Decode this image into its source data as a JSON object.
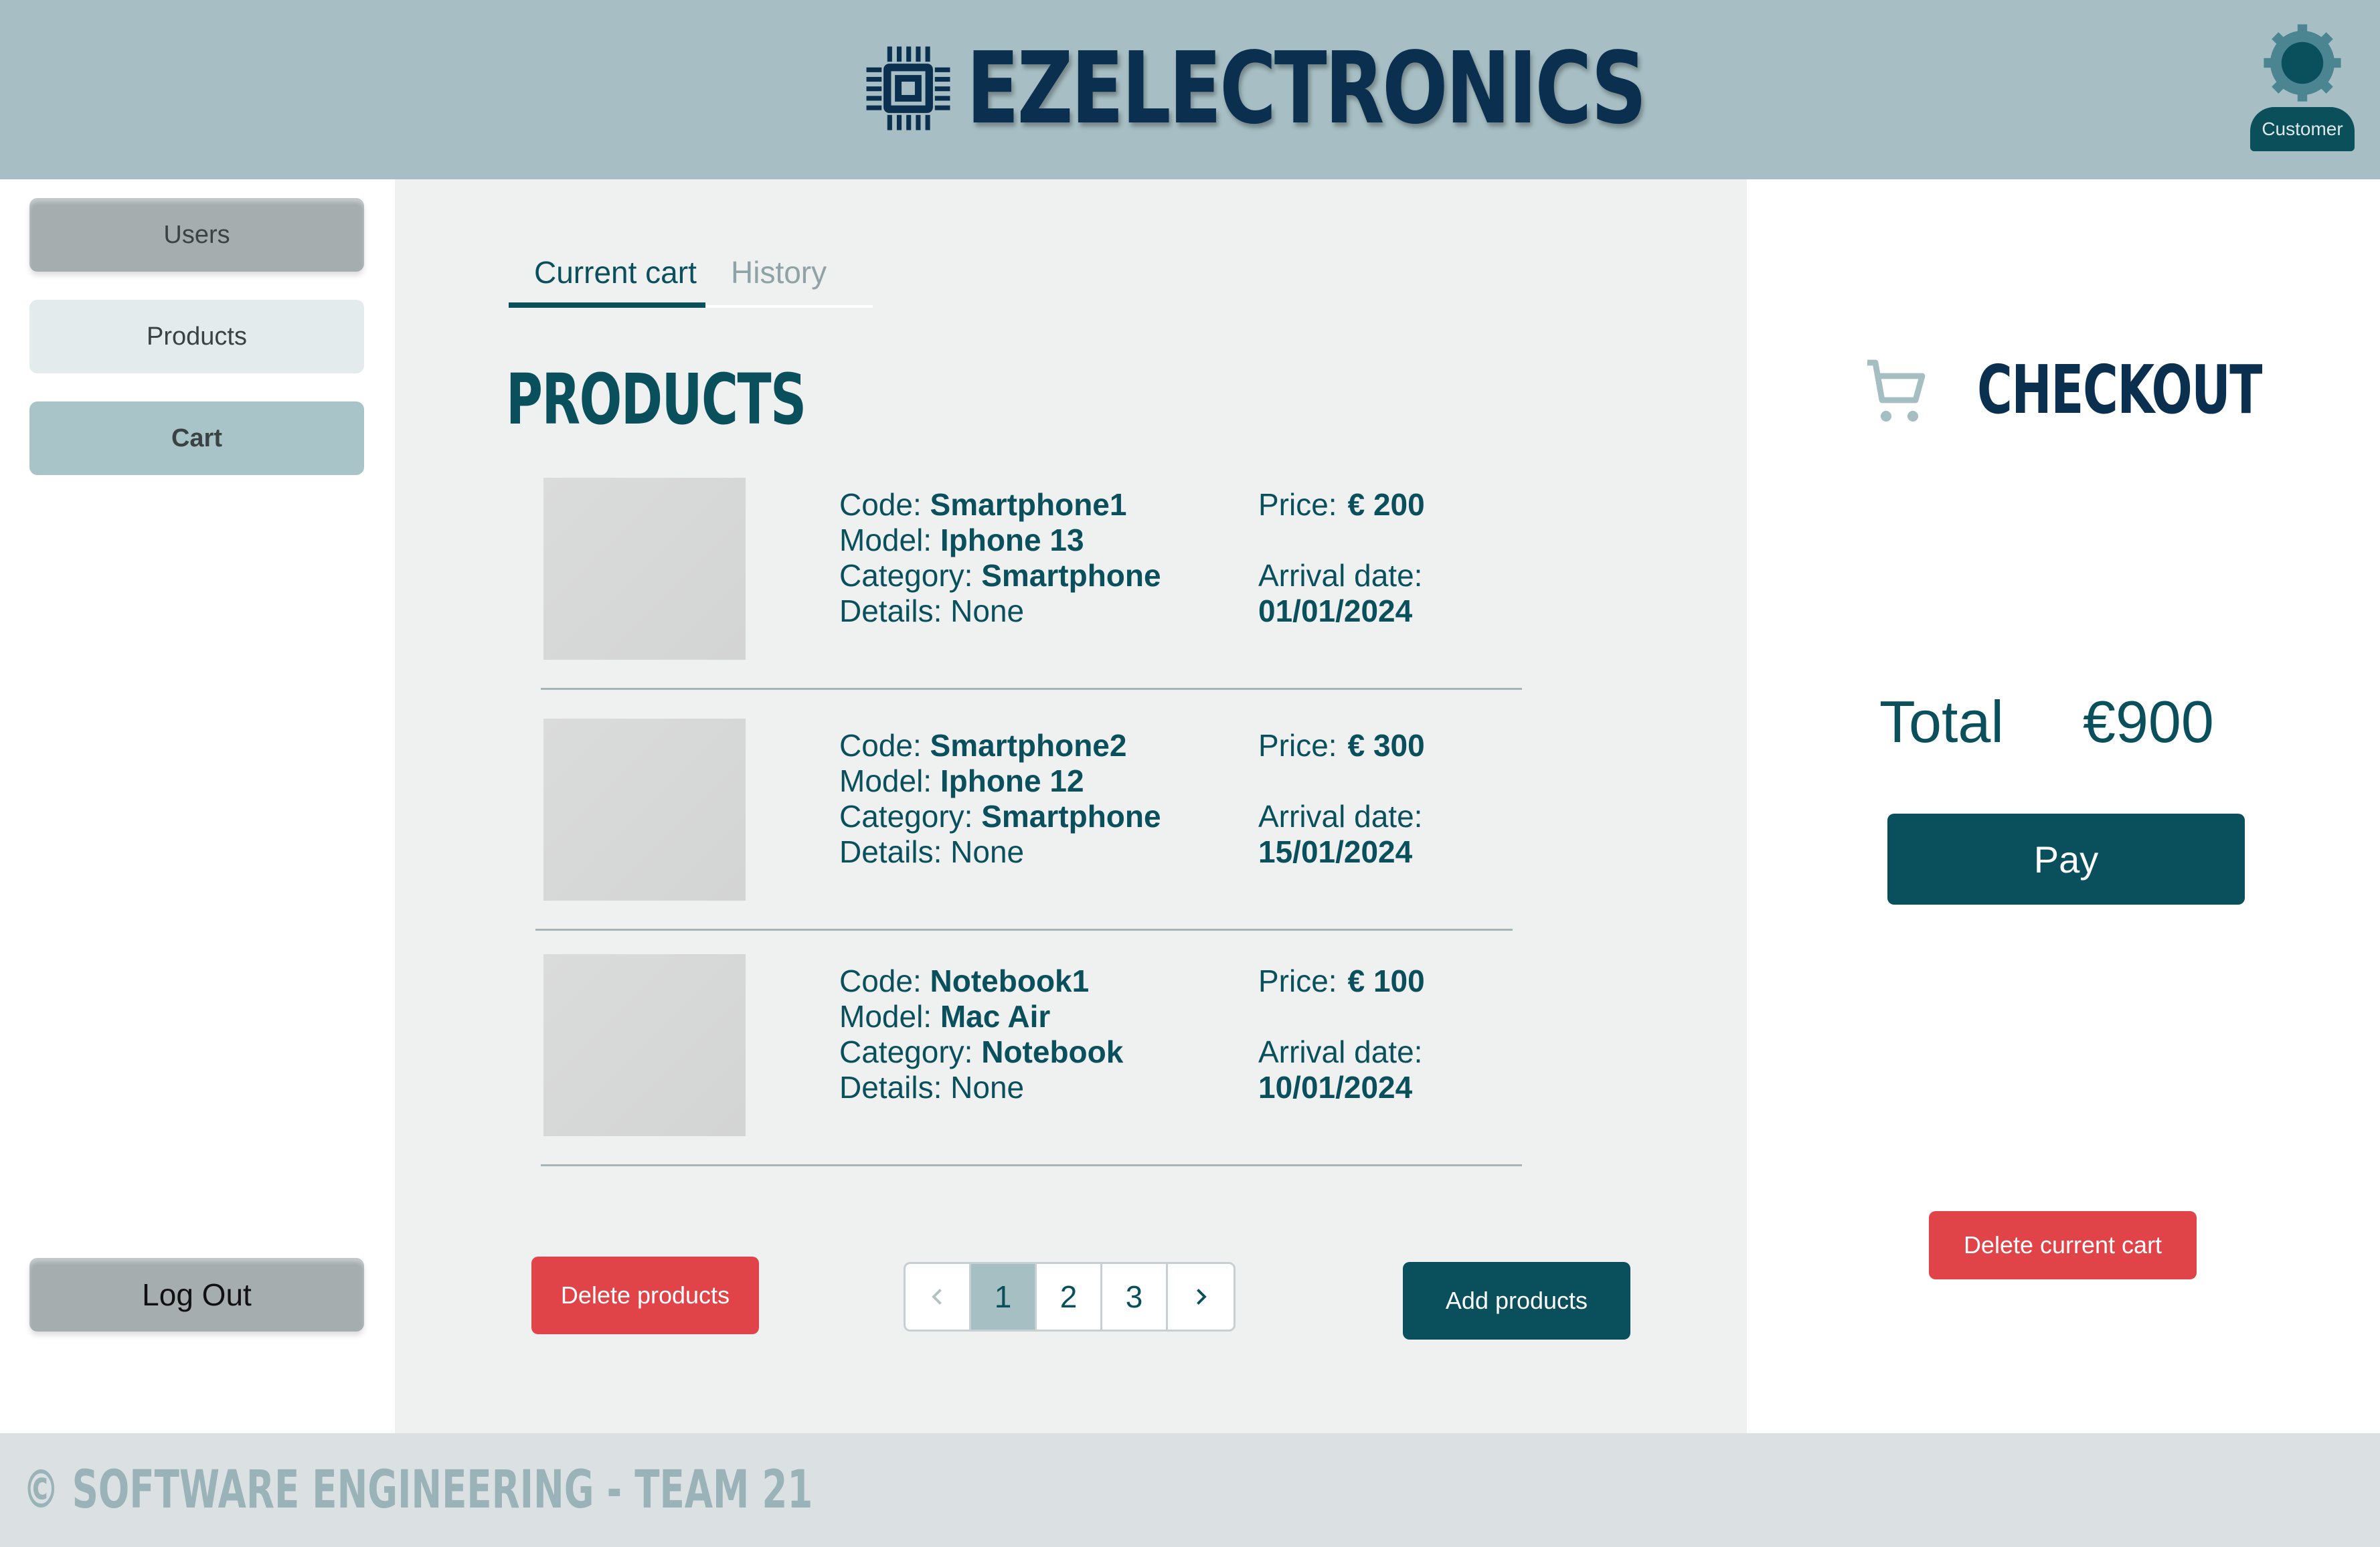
{
  "header": {
    "brand": "EZELECTRONICS",
    "user_role": "Customer",
    "logo_icon": "chip-icon",
    "settings_icon": "gear-icon"
  },
  "sidebar": {
    "items": [
      {
        "label": "Users"
      },
      {
        "label": "Products"
      },
      {
        "label": "Cart"
      }
    ],
    "logout_label": "Log Out"
  },
  "main": {
    "tabs": [
      {
        "label": "Current cart",
        "active": true
      },
      {
        "label": "History",
        "active": false
      }
    ],
    "title": "PRODUCTS",
    "labels": {
      "code": "Code:",
      "model": "Model:",
      "category": "Category:",
      "details": "Details:",
      "price": "Price:",
      "arrival": "Arrival date:"
    },
    "products": [
      {
        "code": "Smartphone1",
        "model": "Iphone 13",
        "category": "Smartphone",
        "details": "None",
        "price": "€ 200",
        "arrival_date": "01/01/2024"
      },
      {
        "code": "Smartphone2",
        "model": "Iphone 12",
        "category": "Smartphone",
        "details": "None",
        "price": "€ 300",
        "arrival_date": "15/01/2024"
      },
      {
        "code": "Notebook1",
        "model": "Mac Air",
        "category": "Notebook",
        "details": "None",
        "price": "€ 100",
        "arrival_date": "10/01/2024"
      }
    ],
    "delete_products_label": "Delete products",
    "add_products_label": "Add products",
    "pagination": {
      "pages": [
        "1",
        "2",
        "3"
      ],
      "current": "1",
      "prev_icon": "chevron-left-icon",
      "next_icon": "chevron-right-icon"
    }
  },
  "checkout": {
    "title": "CHECKOUT",
    "cart_icon": "cart-icon",
    "total_label": "Total",
    "total_value": "€900",
    "pay_label": "Pay",
    "delete_cart_label": "Delete current cart"
  },
  "footer": {
    "text": "© SOFTWARE ENGINEERING - TEAM 21"
  },
  "colors": {
    "header_bg": "#a7bfc4",
    "brand_dark": "#0b2f4e",
    "accent": "#0a4f5c",
    "danger": "#e04448",
    "main_bg": "#eff0f0",
    "footer_bg": "#dbe1e2"
  }
}
